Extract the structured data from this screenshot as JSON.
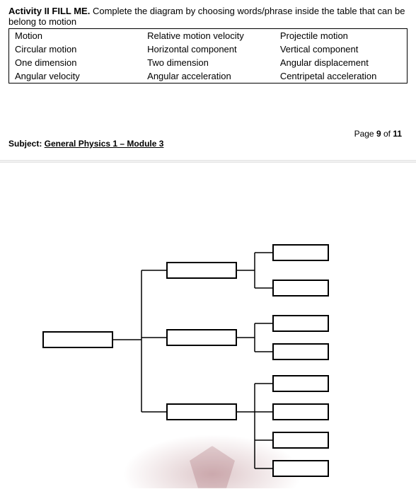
{
  "activity": {
    "title_bold": "Activity II FILL ME.",
    "title_rest": " Complete the diagram by choosing words/phrase inside the table that can be belong to motion"
  },
  "word_table": {
    "rows": [
      [
        "Motion",
        "Relative motion velocity",
        "Projectile motion"
      ],
      [
        "Circular motion",
        "Horizontal component",
        "Vertical component"
      ],
      [
        "One dimension",
        "Two dimension",
        "Angular displacement"
      ],
      [
        "Angular velocity",
        "Angular acceleration",
        "Centripetal acceleration"
      ]
    ]
  },
  "page_info": {
    "prefix": "Page ",
    "current": "9",
    "of_word": " of ",
    "total": "11"
  },
  "subject": {
    "label": "Subject: ",
    "link_text": "General Physics 1 – Module 3"
  },
  "diagram": {
    "root": "",
    "middle": [
      "",
      "",
      ""
    ],
    "leaves_group1": [
      "",
      ""
    ],
    "leaves_group2": [
      "",
      ""
    ],
    "leaves_group3": [
      "",
      "",
      "",
      ""
    ]
  }
}
